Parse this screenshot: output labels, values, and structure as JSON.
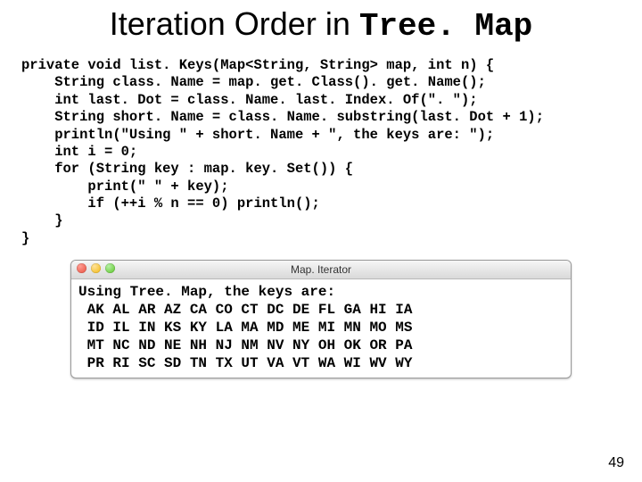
{
  "title": {
    "prefix": "Iteration Order in ",
    "mono": "Tree. Map"
  },
  "code": "private void list. Keys(Map<String, String> map, int n) {\n    String class. Name = map. get. Class(). get. Name();\n    int last. Dot = class. Name. last. Index. Of(\". \");\n    String short. Name = class. Name. substring(last. Dot + 1);\n    println(\"Using \" + short. Name + \", the keys are: \");\n    int i = 0;\n    for (String key : map. key. Set()) {\n        print(\" \" + key);\n        if (++i % n == 0) println();\n    }\n}",
  "window": {
    "title": "Map. Iterator",
    "output": "Using Tree. Map, the keys are:\n AK AL AR AZ CA CO CT DC DE FL GA HI IA\n ID IL IN KS KY LA MA MD ME MI MN MO MS\n MT NC ND NE NH NJ NM NV NY OH OK OR PA\n PR RI SC SD TN TX UT VA VT WA WI WV WY"
  },
  "page_number": "49"
}
